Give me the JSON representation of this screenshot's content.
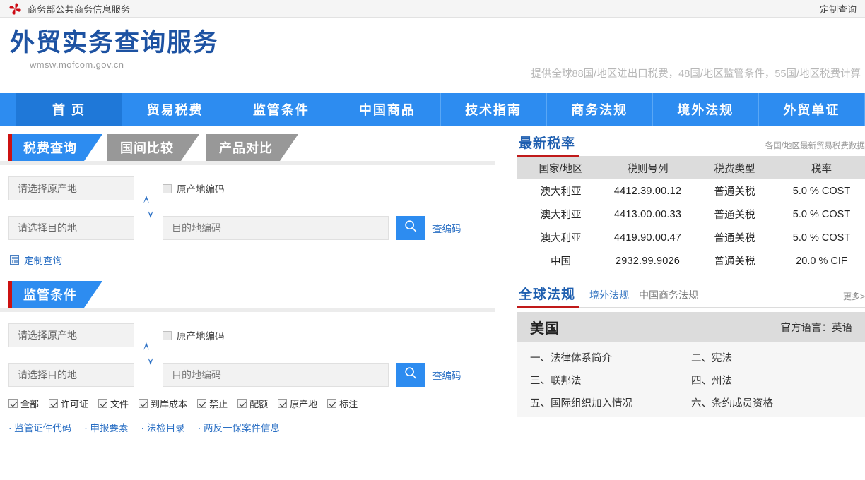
{
  "topbar": {
    "logo_alt": "mofcom-pinwheel-logo",
    "title": "商务部公共商务信息服务",
    "custom_query": "定制查询"
  },
  "masthead": {
    "title": "外贸实务查询服务",
    "url": "wmsw.mofcom.gov.cn",
    "slogan": "提供全球88国/地区进出口税费，48国/地区监管条件，55国/地区税费计算"
  },
  "mainnav": {
    "items": [
      {
        "label": "首 页",
        "active": true
      },
      {
        "label": "贸易税费",
        "active": false
      },
      {
        "label": "监管条件",
        "active": false
      },
      {
        "label": "中国商品",
        "active": false
      },
      {
        "label": "技术指南",
        "active": false
      },
      {
        "label": "商务法规",
        "active": false
      },
      {
        "label": "境外法规",
        "active": false
      },
      {
        "label": "外贸单证",
        "active": false
      }
    ]
  },
  "tabs": {
    "items": [
      {
        "label": "税费查询",
        "active": true
      },
      {
        "label": "国间比较",
        "active": false
      },
      {
        "label": "产品对比",
        "active": false
      }
    ]
  },
  "tax_form": {
    "origin_select": "请选择原产地",
    "destination_select": "请选择目的地",
    "origin_code_label": "原产地编码",
    "destination_code_placeholder": "目的地编码",
    "search_icon": "magnifier-icon",
    "swap_icon": "swap-vertical-icon",
    "code_lookup_link": "查编码"
  },
  "custom_query_link": {
    "icon": "calculator-icon",
    "label": "定制查询"
  },
  "regulation_section": {
    "title": "监管条件",
    "origin_select": "请选择原产地",
    "destination_select": "请选择目的地",
    "origin_code_label": "原产地编码",
    "destination_code_placeholder": "目的地编码",
    "code_lookup_link": "查编码",
    "checkboxes": [
      {
        "label": "全部",
        "checked": true
      },
      {
        "label": "许可证",
        "checked": true
      },
      {
        "label": "文件",
        "checked": true
      },
      {
        "label": "到岸成本",
        "checked": true
      },
      {
        "label": "禁止",
        "checked": true
      },
      {
        "label": "配额",
        "checked": true
      },
      {
        "label": "原产地",
        "checked": true
      },
      {
        "label": "标注",
        "checked": true
      }
    ],
    "links": [
      "监管证件代码",
      "申报要素",
      "法检目录",
      "两反一保案件信息"
    ]
  },
  "latest_rates": {
    "title": "最新税率",
    "note": "各国/地区最新贸易税费数据",
    "columns": [
      "国家/地区",
      "税则号列",
      "税费类型",
      "税率"
    ],
    "rows": [
      [
        "澳大利亚",
        "4412.39.00.12",
        "普通关税",
        "5.0 % COST"
      ],
      [
        "澳大利亚",
        "4413.00.00.33",
        "普通关税",
        "5.0 % COST"
      ],
      [
        "澳大利亚",
        "4419.90.00.47",
        "普通关税",
        "5.0 % COST"
      ],
      [
        "中国",
        "2932.99.9026",
        "普通关税",
        "20.0 % CIF"
      ]
    ]
  },
  "global_laws": {
    "title": "全球法规",
    "subtabs": [
      "境外法规",
      "中国商务法规"
    ],
    "more": "更多>",
    "country": "美国",
    "language_label": "官方语言：英语",
    "items": [
      "一、法律体系简介",
      "二、宪法",
      "三、联邦法",
      "四、州法",
      "五、国际组织加入情况",
      "六、条约成员资格"
    ]
  }
}
